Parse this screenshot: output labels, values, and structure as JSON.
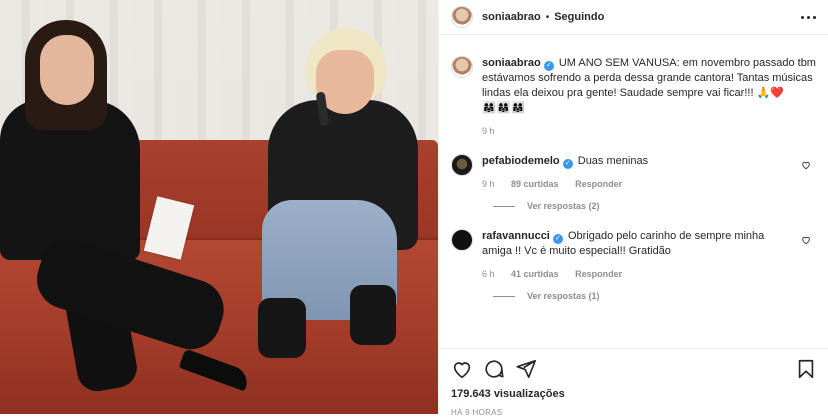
{
  "post": {
    "username": "soniaabrao",
    "following_label": "Seguindo",
    "caption_user": "soniaabrao",
    "caption_text": "UM ANO SEM VANUSA: em novembro passado tbm estávamos sofrendo a perda dessa grande cantora! Tantas músicas lindas ela deixou pra gente! Saudade sempre vai ficar!!! 🙏❤️",
    "caption_emojis": "👩‍👩‍👧👩‍👩‍👧👩‍👩‍👧",
    "caption_time": "9 h"
  },
  "comments": [
    {
      "user": "pefabiodemelo",
      "text": "Duas meninas",
      "time": "9 h",
      "likes": "89 curtidas",
      "reply": "Responder",
      "view_replies": "Ver respostas (2)"
    },
    {
      "user": "rafavannucci",
      "text": "Obrigado pelo carinho de sempre minha amiga !! Vc é muito especial!! Gratidão",
      "time": "6 h",
      "likes": "41 curtidas",
      "reply": "Responder",
      "view_replies": "Ver respostas (1)"
    }
  ],
  "footer": {
    "views": "179.643 visualizações",
    "date": "HÁ 9 HORAS"
  },
  "icons": {
    "like": "heart-icon",
    "comment": "comment-icon",
    "share": "paper-plane-icon",
    "save": "bookmark-icon",
    "more": "more-options-icon"
  },
  "colors": {
    "verified": "#3897f0",
    "text": "#262626",
    "muted": "#8e8e8e"
  }
}
